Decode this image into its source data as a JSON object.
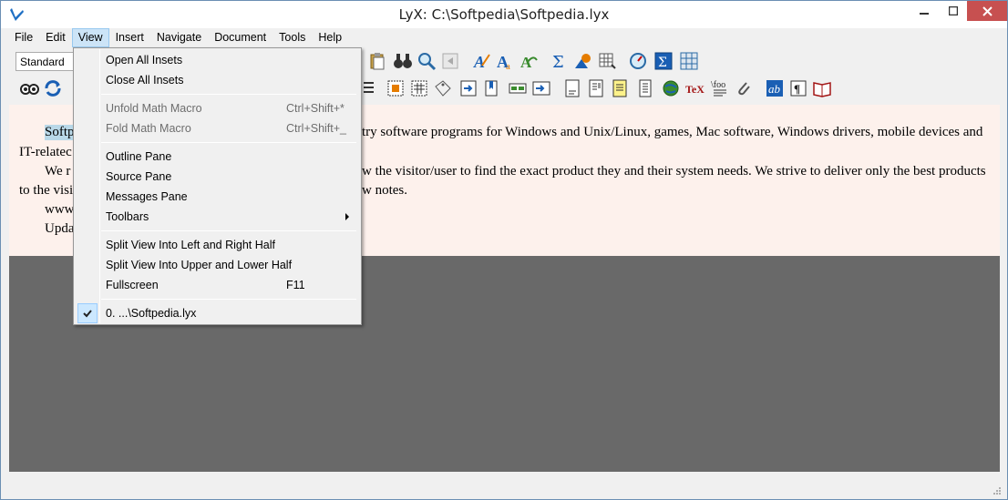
{
  "window": {
    "title": "LyX: C:\\Softpedia\\Softpedia.lyx"
  },
  "menubar": {
    "items": [
      "File",
      "Edit",
      "View",
      "Insert",
      "Navigate",
      "Document",
      "Tools",
      "Help"
    ],
    "active": "View"
  },
  "toolbar": {
    "paragraph_style": "Standard"
  },
  "document": {
    "lines": [
      "Softp",
      "try software programs for Windows and Unix/Linux, games, Mac software, Windows drivers, mobile devices and",
      "IT-relatec",
      "We r",
      "w the visitor/user to find the exact product they and their system needs. We strive to deliver only the best products",
      "to the visi",
      "w notes.",
      "www",
      "Upda"
    ]
  },
  "view_menu": {
    "items": [
      {
        "label": "Open All Insets",
        "shortcut": "",
        "enabled": true
      },
      {
        "label": "Close All Insets",
        "shortcut": "",
        "enabled": true
      },
      {
        "label": "Unfold Math Macro",
        "shortcut": "Ctrl+Shift+*",
        "enabled": false
      },
      {
        "label": "Fold Math Macro",
        "shortcut": "Ctrl+Shift+_",
        "enabled": false
      },
      {
        "label": "Outline Pane",
        "shortcut": "",
        "enabled": true
      },
      {
        "label": "Source Pane",
        "shortcut": "",
        "enabled": true
      },
      {
        "label": "Messages Pane",
        "shortcut": "",
        "enabled": true
      },
      {
        "label": "Toolbars",
        "shortcut": "",
        "enabled": true,
        "submenu": true
      },
      {
        "label": "Split View Into Left and Right Half",
        "shortcut": "",
        "enabled": true
      },
      {
        "label": "Split View Into Upper and Lower Half",
        "shortcut": "",
        "enabled": true
      },
      {
        "label": "Fullscreen",
        "shortcut": "F11",
        "enabled": true
      },
      {
        "label": "0. ...\\Softpedia.lyx",
        "shortcut": "",
        "enabled": true,
        "checked": true
      }
    ]
  },
  "colors": {
    "document_bg": "#fdf1ec",
    "empty_area": "#696969",
    "selection": "#b9d8e8",
    "menu_highlight": "#cce4f7",
    "close_button": "#c75050"
  }
}
